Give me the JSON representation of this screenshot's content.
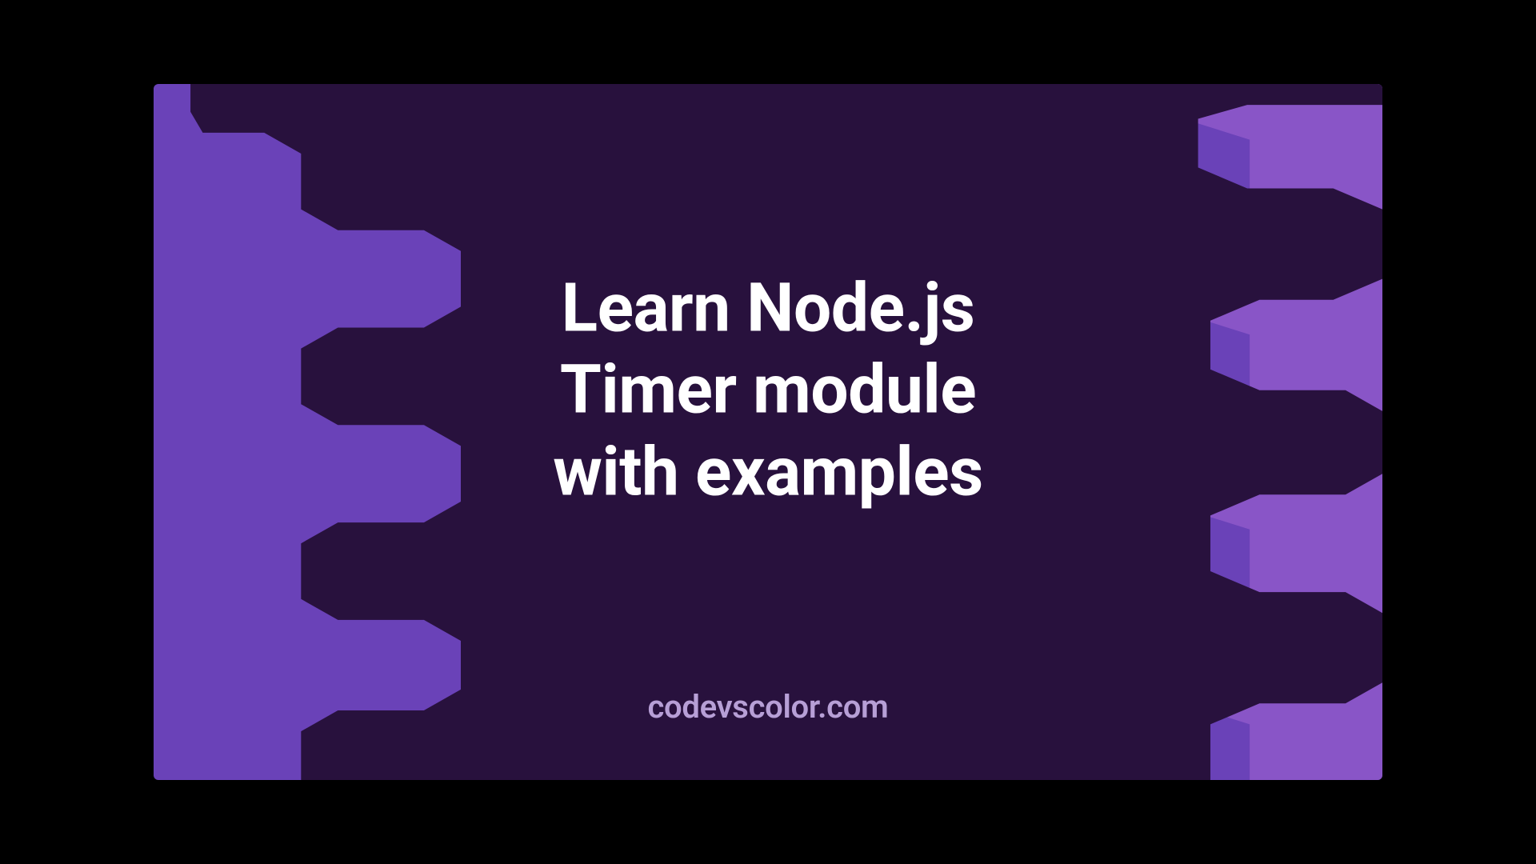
{
  "title_lines": {
    "l1": "Learn Node.js",
    "l2": "Timer module",
    "l3": "with examples"
  },
  "credit": "codevscolor.com",
  "colors": {
    "bg_left_purple": "#6a42b8",
    "bg_right_purple": "#8d58c9",
    "blob_dark": "#28113d",
    "title_color": "#ffffff",
    "credit_color": "#b79fd6"
  }
}
